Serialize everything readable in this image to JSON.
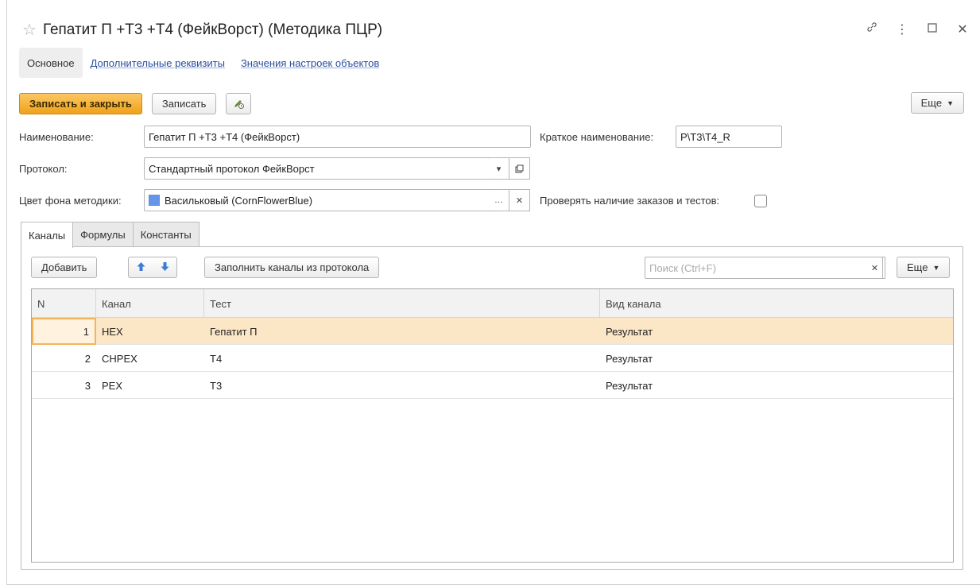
{
  "window": {
    "title": "Гепатит П +Т3 +Т4 (ФейкВорст) (Методика ПЦР)",
    "controls": [
      "link-icon",
      "more-vertical-icon",
      "maximize-icon",
      "close-icon"
    ]
  },
  "top_tabs": [
    {
      "label": "Основное",
      "active": true
    },
    {
      "label": "Дополнительные реквизиты",
      "active": false
    },
    {
      "label": "Значения настроек объектов",
      "active": false
    }
  ],
  "toolbar": {
    "save_close": "Записать и закрыть",
    "save": "Записать",
    "more": "Еще"
  },
  "form": {
    "name_label": "Наименование:",
    "name_value": "Гепатит П +Т3 +Т4 (ФейкВорст)",
    "short_name_label": "Краткое наименование:",
    "short_name_value": "P\\T3\\T4_R",
    "protocol_label": "Протокол:",
    "protocol_value": "Стандартный протокол ФейкВорст",
    "color_label": "Цвет фона методики:",
    "color_value": "Васильковый (CornFlowerBlue)",
    "color_hex": "#6495ed",
    "check_label": "Проверять наличие заказов и тестов:",
    "check_value": false
  },
  "inner_tabs": [
    {
      "label": "Каналы",
      "active": true
    },
    {
      "label": "Формулы",
      "active": false
    },
    {
      "label": "Константы",
      "active": false
    }
  ],
  "panel_toolbar": {
    "add": "Добавить",
    "fill": "Заполнить каналы из протокола",
    "search_placeholder": "Поиск (Ctrl+F)",
    "more": "Еще"
  },
  "table": {
    "columns": [
      "N",
      "Канал",
      "Тест",
      "Вид канала"
    ],
    "rows": [
      {
        "n": "1",
        "channel": "HEX",
        "test": "Гепатит П",
        "kind": "Результат",
        "selected": true
      },
      {
        "n": "2",
        "channel": "CHPEX",
        "test": "Т4",
        "kind": "Результат",
        "selected": false
      },
      {
        "n": "3",
        "channel": "PEX",
        "test": "Т3",
        "kind": "Результат",
        "selected": false
      }
    ]
  },
  "colors": {
    "primary_button": "#f0a21b",
    "selected_row": "#fbe7c6",
    "link": "#2a4f9e"
  }
}
